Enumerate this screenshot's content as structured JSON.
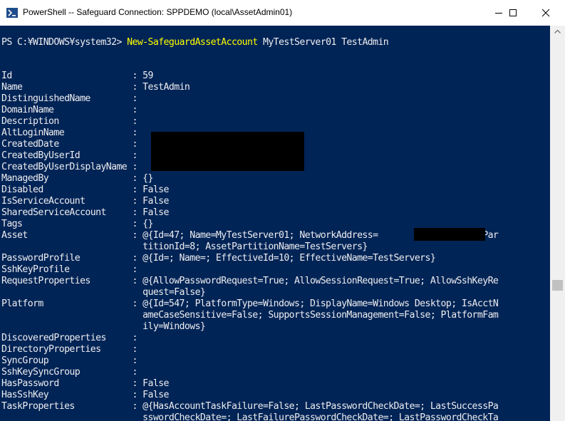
{
  "window": {
    "title": "PowerShell -- Safeguard Connection: SPPDEMO (local\\AssetAdmin01)",
    "icon": "powershell-icon",
    "controls": [
      "minimize-icon",
      "maximize-icon",
      "close-icon"
    ]
  },
  "console": {
    "prompt": "PS C:¥WINDOWS¥system32> ",
    "command": "New-SafeguardAssetAccount",
    "args": " MyTestServer01 TestAdmin",
    "lines": [
      "Id                       : 59",
      "Name                     : TestAdmin",
      "DistinguishedName        :",
      "DomainName               :",
      "Description              :",
      "AltLoginName             :",
      "CreatedDate              :",
      "CreatedByUserId          :",
      "CreatedByUserDisplayName :",
      "ManagedBy                : {}",
      "Disabled                 : False",
      "IsServiceAccount         : False",
      "SharedServiceAccount     : False",
      "Tags                     : {}",
      "Asset                    : @{Id=47; Name=MyTestServer01; NetworkAddress=             ; AssetPar",
      "                           titionId=8; AssetPartitionName=TestServers}",
      "PasswordProfile          : @{Id=; Name=; EffectiveId=10; EffectiveName=TestServers}",
      "SshKeyProfile            :",
      "RequestProperties        : @{AllowPasswordRequest=True; AllowSessionRequest=True; AllowSshKeyRe",
      "                           quest=False}",
      "Platform                 : @{Id=547; PlatformType=Windows; DisplayName=Windows Desktop; IsAcctN",
      "                           ameCaseSensitive=False; SupportsSessionManagement=False; PlatformFam",
      "                           ily=Windows}",
      "DiscoveredProperties     :",
      "DirectoryProperties      :",
      "SyncGroup                :",
      "SshKeySyncGroup          :",
      "HasPassword              : False",
      "HasSshKey                : False",
      "TaskProperties           : @{HasAccountTaskFailure=False; LastPasswordCheckDate=; LastSuccessPa",
      "                           sswordCheckDate=; LastFailurePasswordCheckDate=; LastPasswordCheckTa"
    ]
  },
  "colors": {
    "console_background": "#012456",
    "console_text": "#eeedf0",
    "command_text": "#ffff00",
    "redaction": "#000000"
  }
}
